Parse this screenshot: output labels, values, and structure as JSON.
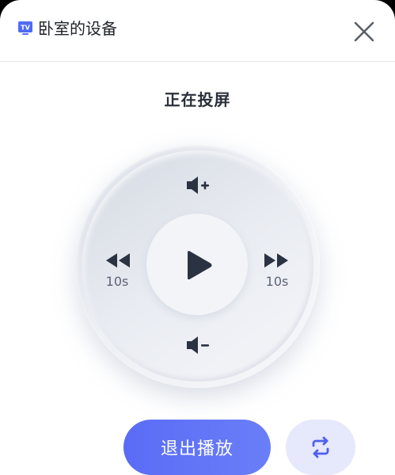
{
  "header": {
    "tv_badge_text": "TV",
    "device_name": "卧室的设备",
    "close_icon": "close-icon"
  },
  "status": {
    "title": "正在投屏"
  },
  "remote": {
    "volume_up_icon": "volume-up-icon",
    "volume_down_icon": "volume-down-icon",
    "play_icon": "play-icon",
    "rewind_icon": "rewind-icon",
    "rewind_label": "10s",
    "forward_icon": "fast-forward-icon",
    "forward_label": "10s"
  },
  "actions": {
    "exit_label": "退出播放",
    "switch_icon": "switch-device-icon"
  },
  "colors": {
    "accent": "#5a6cf6",
    "switch_bg": "#e6e8fb",
    "icon_dark": "#2b3342"
  }
}
